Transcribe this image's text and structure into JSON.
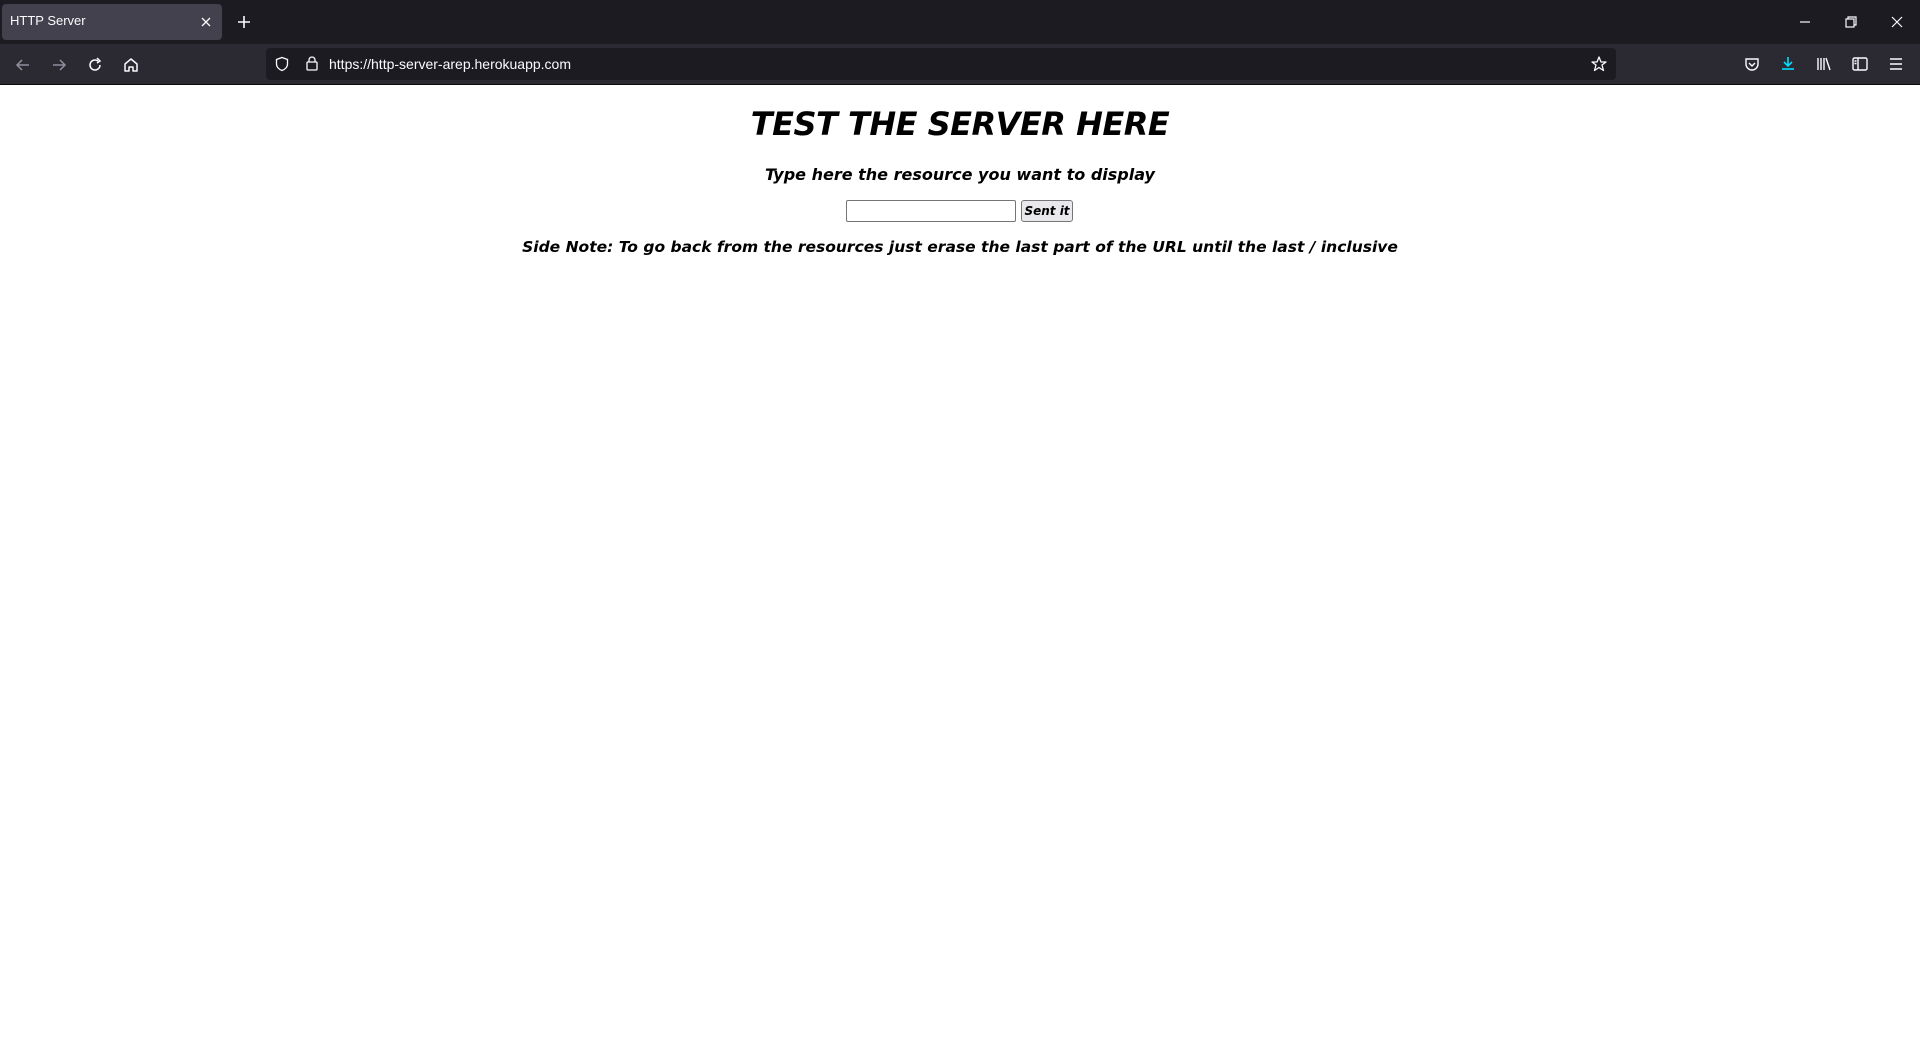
{
  "browser": {
    "tab": {
      "title": "HTTP Server"
    },
    "address_bar": {
      "url": "https://http-server-arep.herokuapp.com"
    }
  },
  "page": {
    "title": "TEST THE SERVER HERE",
    "prompt": "Type here the resource you want to display",
    "resource_input": {
      "value": "",
      "placeholder": ""
    },
    "submit_label": "Sent it",
    "side_note": "Side Note: To go back from the resources just erase the last part of the URL until the last / inclusive"
  },
  "colors": {
    "tabbar_bg": "#1c1b22",
    "toolbar_bg": "#2b2a33",
    "active_tab_bg": "#42414d",
    "download_accent": "#00ddff"
  }
}
